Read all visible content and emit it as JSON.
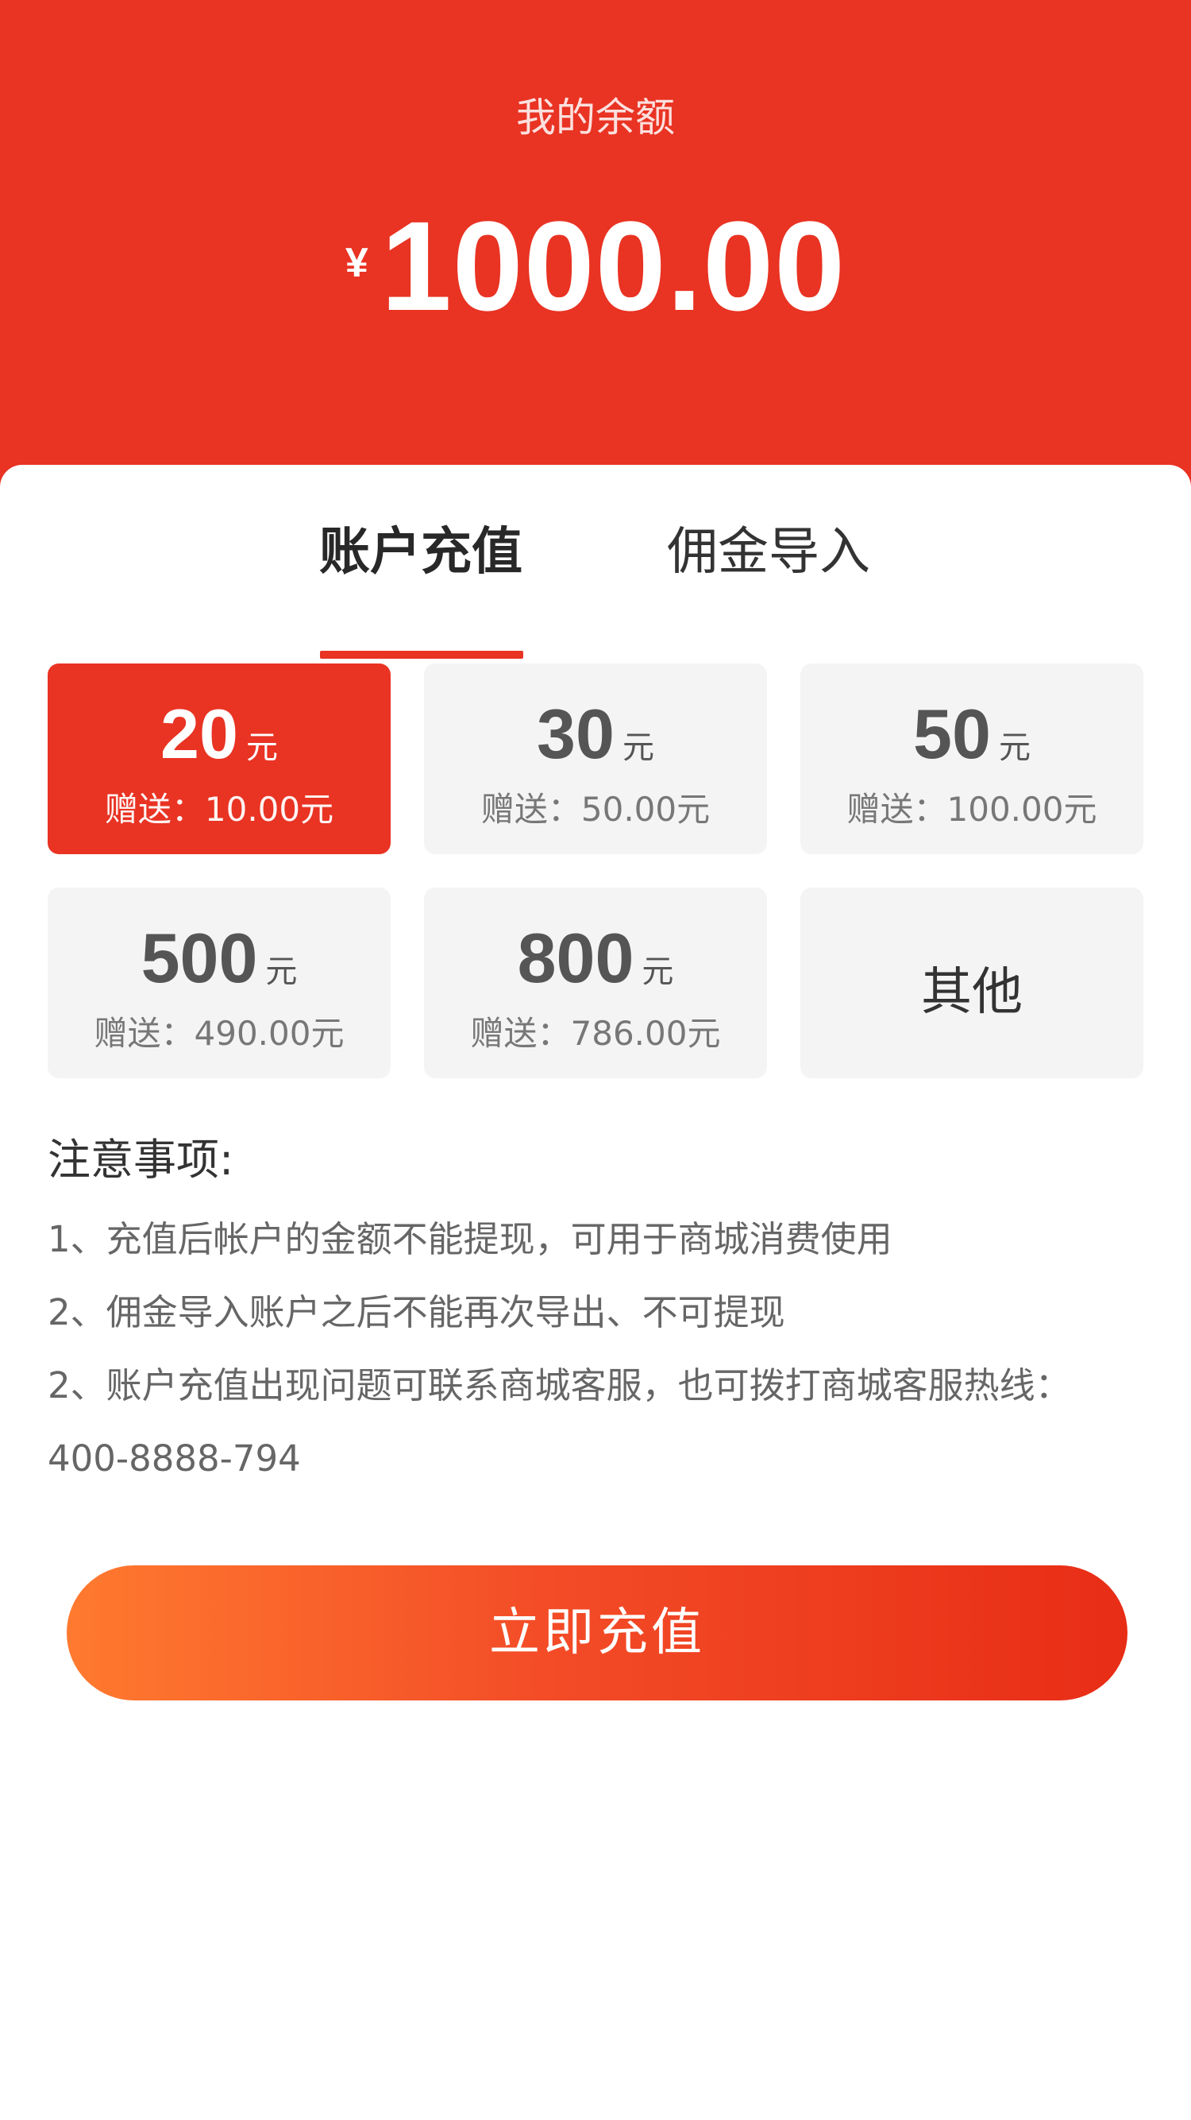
{
  "header": {
    "title": "我的余额",
    "currency": "¥",
    "amount": "1000.00",
    "bg_color": "#e93323"
  },
  "tabs": [
    {
      "label": "账户充值",
      "active": true
    },
    {
      "label": "佣金导入",
      "active": false
    }
  ],
  "recharge_options": [
    {
      "amount": "20",
      "unit": "元",
      "gift": "赠送：10.00元",
      "selected": true
    },
    {
      "amount": "30",
      "unit": "元",
      "gift": "赠送：50.00元",
      "selected": false
    },
    {
      "amount": "50",
      "unit": "元",
      "gift": "赠送：100.00元",
      "selected": false
    },
    {
      "amount": "500",
      "unit": "元",
      "gift": "赠送：490.00元",
      "selected": false
    },
    {
      "amount": "800",
      "unit": "元",
      "gift": "赠送：786.00元",
      "selected": false
    },
    {
      "label": "其他"
    }
  ],
  "notes": {
    "title": "注意事项:",
    "items": [
      "1、充值后帐户的金额不能提现，可用于商城消费使用",
      "2、佣金导入账户之后不能再次导出、不可提现",
      "2、账户充值出现问题可联系商城客服，也可拨打商城客服热线：",
      "400-8888-794"
    ]
  },
  "submit_button": {
    "label": "立即充值"
  }
}
